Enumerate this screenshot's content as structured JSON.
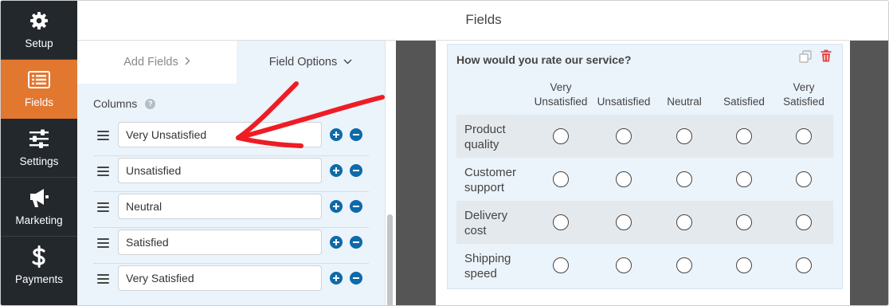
{
  "nav": {
    "items": [
      {
        "label": "Setup",
        "icon": "gear-icon"
      },
      {
        "label": "Fields",
        "icon": "fields-list-icon"
      },
      {
        "label": "Settings",
        "icon": "sliders-icon"
      },
      {
        "label": "Marketing",
        "icon": "megaphone-icon"
      },
      {
        "label": "Payments",
        "icon": "dollar-icon"
      }
    ],
    "active": "Fields",
    "accent_color": "#e27730",
    "background_color": "#23282d"
  },
  "header": {
    "title": "Fields"
  },
  "panel": {
    "tabs": {
      "add_fields": "Add Fields",
      "field_options": "Field Options"
    },
    "columns_label": "Columns",
    "columns": [
      {
        "value": "Very Unsatisfied"
      },
      {
        "value": "Unsatisfied"
      },
      {
        "value": "Neutral"
      },
      {
        "value": "Satisfied"
      },
      {
        "value": "Very Satisfied"
      }
    ],
    "button_color": "#0e6aa8"
  },
  "preview": {
    "question": "How would you rate our service?",
    "columns": [
      {
        "line1": "Very",
        "line2": "Unsatisfied"
      },
      {
        "line1": "",
        "line2": "Unsatisfied"
      },
      {
        "line1": "",
        "line2": "Neutral"
      },
      {
        "line1": "",
        "line2": "Satisfied"
      },
      {
        "line1": "Very",
        "line2": "Satisfied"
      }
    ],
    "rows": [
      {
        "line1": "Product",
        "line2": "quality"
      },
      {
        "line1": "Customer",
        "line2": "support"
      },
      {
        "line1": "Delivery",
        "line2": "cost"
      },
      {
        "line1": "Shipping",
        "line2": "speed"
      }
    ]
  },
  "annotation": {
    "color": "#ee1c25"
  }
}
